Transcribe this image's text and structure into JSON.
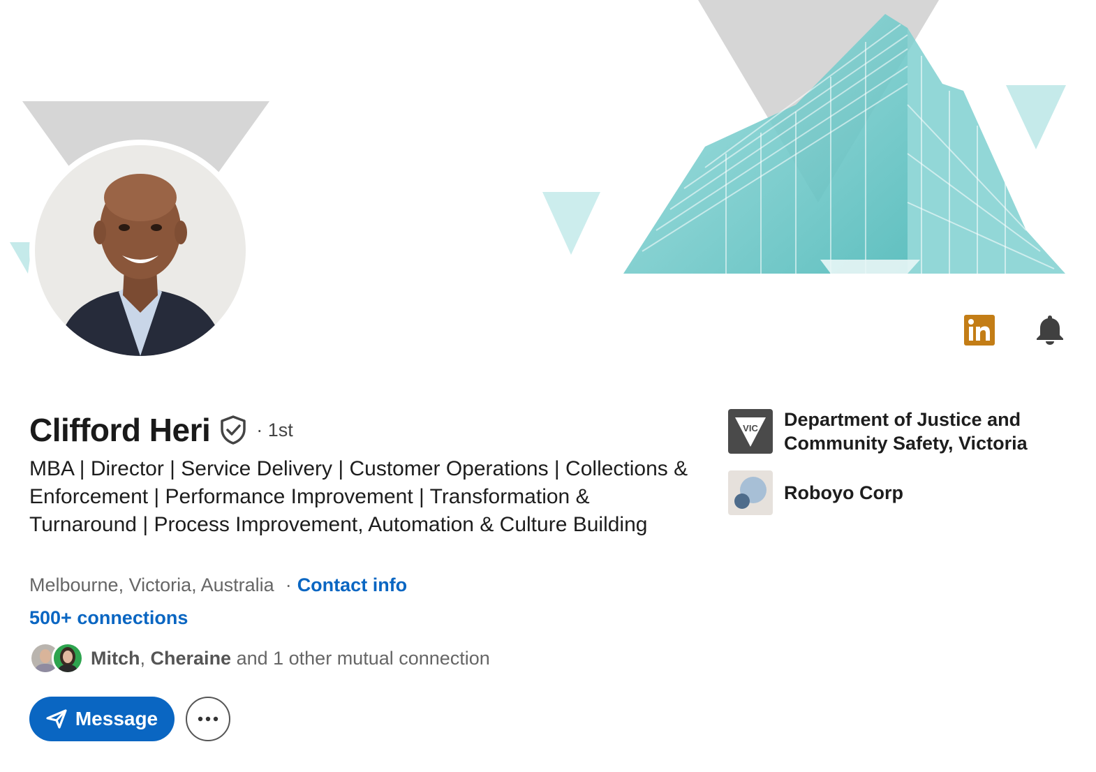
{
  "profile": {
    "name": "Clifford Heri",
    "degree": "· 1st",
    "headline": "MBA | Director | Service Delivery | Customer Operations | Collections & Enforcement | Performance Improvement | Transformation & Turnaround | Process Improvement, Automation & Culture Building",
    "location": "Melbourne, Victoria, Australia",
    "location_separator": "·",
    "contact_info_label": "Contact info",
    "connections_label": "500+ connections",
    "mutual": {
      "name_1": "Mitch",
      "separator": ",",
      "name_2": "Cheraine",
      "suffix": " and 1 other mutual connection"
    }
  },
  "actions": {
    "message_label": "Message",
    "more_icon": "ellipsis-icon"
  },
  "header_icons": {
    "linkedin_icon": "linkedin-icon",
    "bell_icon": "bell-icon"
  },
  "organizations": [
    {
      "name": "Department of Justice and Community Safety, Victoria",
      "logo_text": "VIC"
    },
    {
      "name": "Roboyo Corp"
    }
  ],
  "colors": {
    "accent_blue": "#0a66c2",
    "linkedin_badge": "#c37d16",
    "banner_teal": "#66c6c6",
    "banner_gray": "#d9d9d9"
  }
}
